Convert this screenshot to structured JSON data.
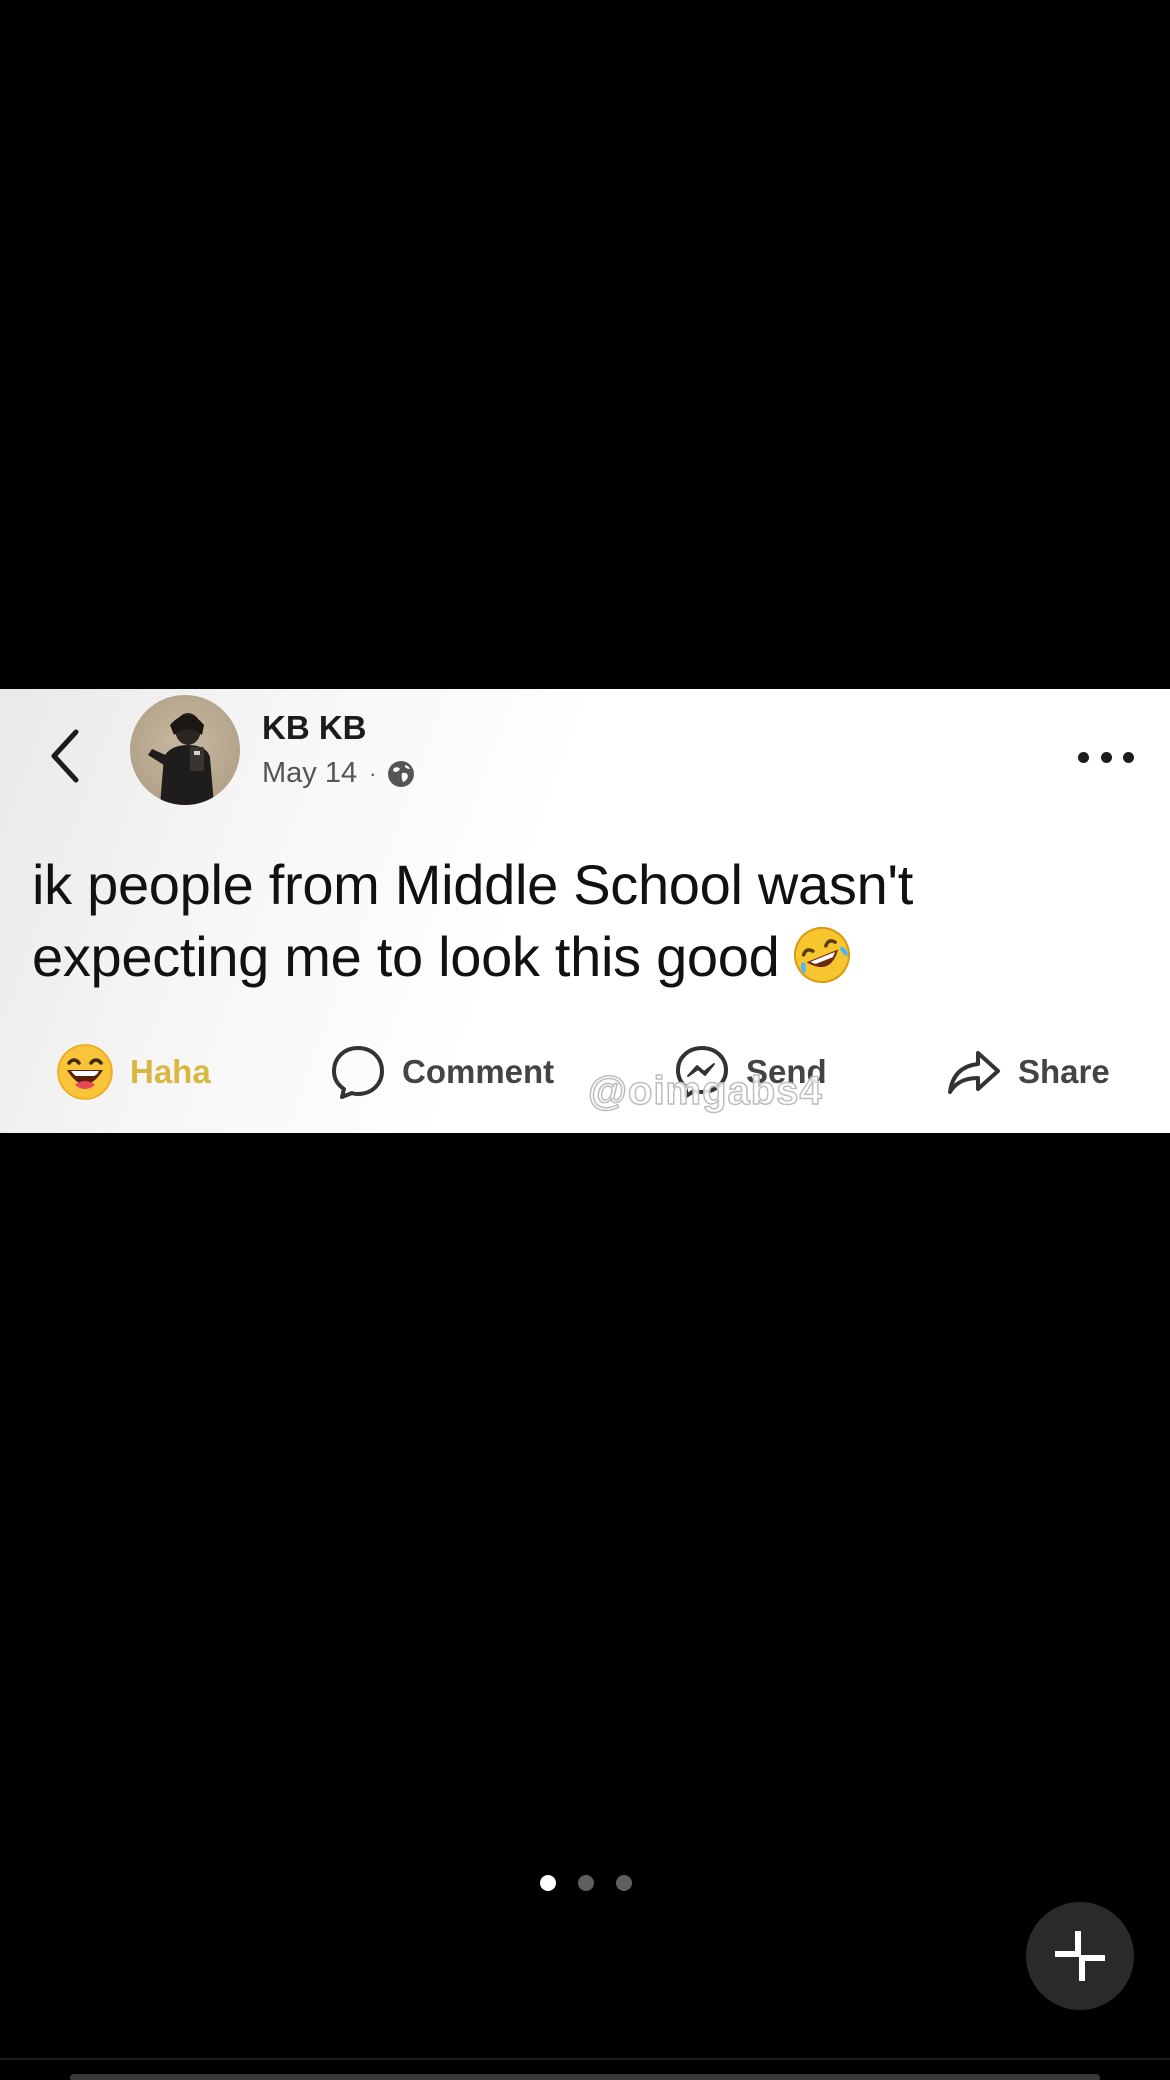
{
  "post": {
    "author_name": "KB KB",
    "date": "May 14",
    "meta_separator": "·",
    "visibility_icon": "globe-icon",
    "text": "ik people from Middle School wasn't expecting me to look this good",
    "text_emoji": "rolling-on-floor-laughing-emoji"
  },
  "actions": {
    "haha_label": "Haha",
    "comment_label": "Comment",
    "send_label": "Send",
    "share_label": "Share"
  },
  "watermark": "@oimgabs4",
  "pager": {
    "total": 3,
    "active_index": 0
  },
  "colors": {
    "background": "#000000",
    "card": "#ffffff",
    "haha_label": "#d8b83e",
    "pager_active": "#ffffff",
    "pager_inactive": "#5e5e5e"
  }
}
